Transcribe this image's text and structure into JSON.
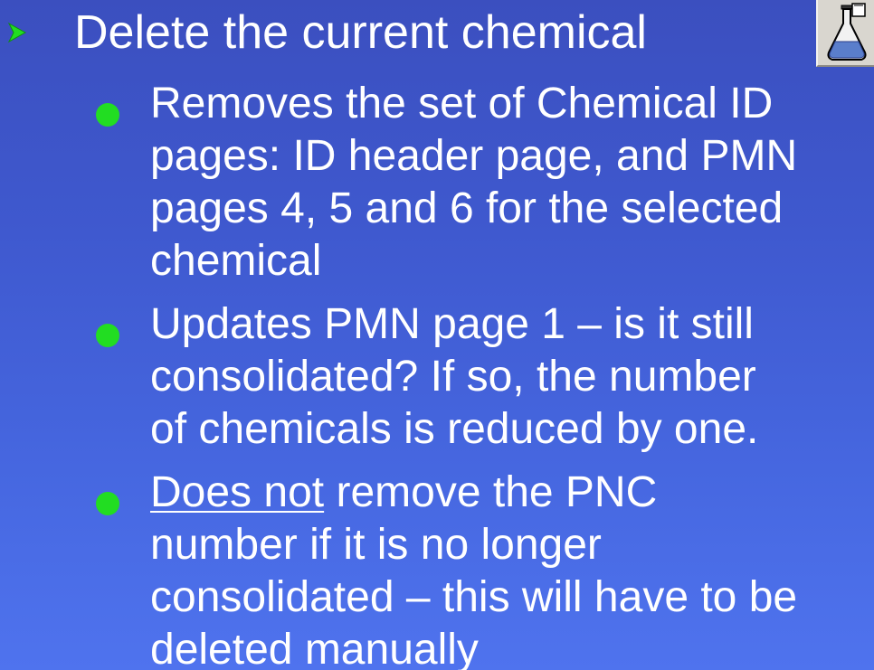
{
  "slide": {
    "main_bullet": {
      "text": "Delete the current chemical",
      "icon": "flask-icon"
    },
    "sub_bullets": [
      {
        "text": "Removes the set of Chemical ID\npages: ID header page, and PMN\npages 4, 5 and 6 for the selected\nchemical"
      },
      {
        "text": "Updates PMN page 1 – is it still\nconsolidated?  If so, the number\nof chemicals is reduced by one."
      },
      {
        "underlined": "Does not",
        "text": " remove the PNC\nnumber if it is no longer\nconsolidated – this will have to be\ndeleted manually"
      }
    ],
    "colors": {
      "background_top": "#3b4fbf",
      "background_bottom": "#4f73ee",
      "bullet_dot": "#22dd22",
      "arrow_bullet": "#22dd22",
      "text": "#ffffff"
    }
  }
}
